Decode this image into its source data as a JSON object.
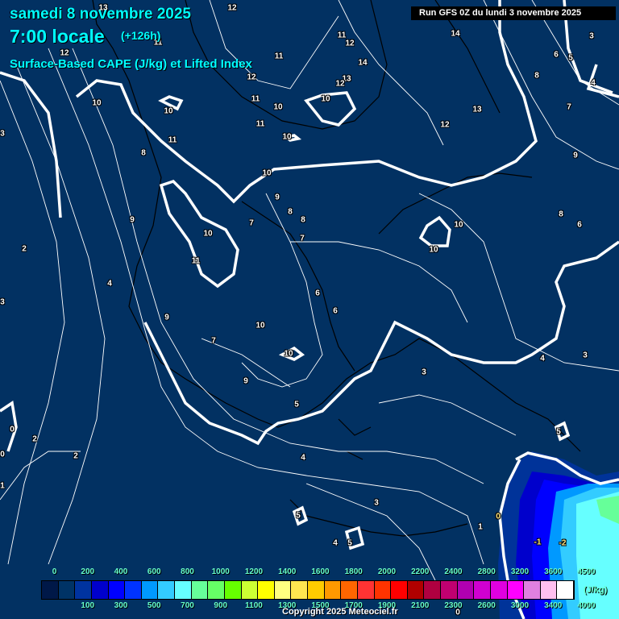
{
  "header": {
    "date": "samedi 8 novembre 2025",
    "time": "7:00 locale",
    "lead": "(+126h)",
    "parameter": "Surface-Based CAPE (J/kg) et Lifted Index",
    "run": "Run GFS 0Z du lundi 3 novembre 2025"
  },
  "contour_labels": [
    "13",
    "12",
    "12",
    "11",
    "11",
    "12",
    "14",
    "3",
    "14",
    "6",
    "5",
    "11",
    "12",
    "13",
    "12",
    "8",
    "4",
    "10",
    "10",
    "10",
    "10",
    "11",
    "7",
    "13",
    "12",
    "11",
    "11",
    "10",
    "3",
    "8",
    "9",
    "10",
    "9",
    "8",
    "8",
    "7",
    "9",
    "8",
    "10",
    "6",
    "7",
    "10",
    "2",
    "10",
    "11",
    "4",
    "6",
    "3",
    "6",
    "9",
    "10",
    "7",
    "10",
    "4",
    "3",
    "3",
    "9",
    "5",
    "0",
    "5",
    "2",
    "2",
    "4",
    "0",
    "1",
    "3",
    "5",
    "0",
    "1",
    "-1",
    "-2",
    "4",
    "5",
    "0"
  ],
  "legend": {
    "unit": "(J/kg)",
    "top_ticks": [
      "0",
      "200",
      "400",
      "600",
      "800",
      "1000",
      "1200",
      "1400",
      "1600",
      "1800",
      "2000",
      "2200",
      "2400",
      "2800",
      "3200",
      "3600",
      "4500"
    ],
    "bottom_ticks": [
      "100",
      "300",
      "500",
      "700",
      "900",
      "1100",
      "1300",
      "1500",
      "1700",
      "1900",
      "2100",
      "2300",
      "2600",
      "3000",
      "3400",
      "4000"
    ],
    "colors": [
      "#001848",
      "#003366",
      "#0033a0",
      "#0000cc",
      "#0000ff",
      "#0033ff",
      "#0099ff",
      "#33ccff",
      "#66ffff",
      "#66ff99",
      "#66ff66",
      "#66ff00",
      "#ccff33",
      "#ffff00",
      "#ffff80",
      "#ffe650",
      "#ffcc00",
      "#ff9900",
      "#ff6600",
      "#ff3333",
      "#ff3300",
      "#ff0000",
      "#b00000",
      "#b00040",
      "#c00070",
      "#b000b0",
      "#d000d0",
      "#e000e0",
      "#ff00ff",
      "#e080e0",
      "#ffc0f0",
      "#ffffff"
    ]
  },
  "copyright": "Copyright 2025 Meteociel.fr"
}
